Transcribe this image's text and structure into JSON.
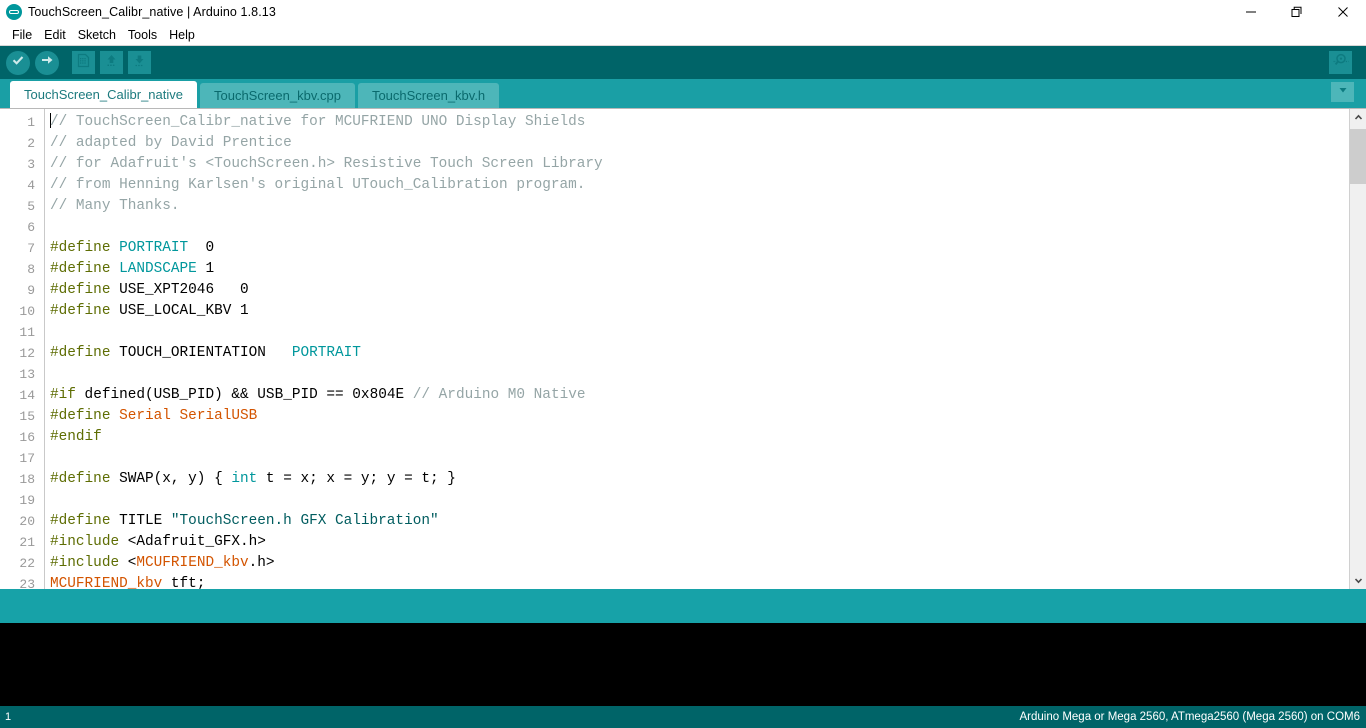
{
  "window": {
    "title": "TouchScreen_Calibr_native | Arduino 1.8.13",
    "app_icon": "arduino-logo-icon",
    "controls": {
      "minimize": "minimize-icon",
      "maximize": "restore-icon",
      "close": "close-icon"
    }
  },
  "menubar": {
    "items": [
      "File",
      "Edit",
      "Sketch",
      "Tools",
      "Help"
    ]
  },
  "toolbar": {
    "buttons": [
      {
        "name": "verify-button",
        "icon": "check-icon",
        "label": "Verify"
      },
      {
        "name": "upload-button",
        "icon": "arrow-right-icon",
        "label": "Upload"
      },
      {
        "name": "new-button",
        "icon": "new-document-icon",
        "label": "New"
      },
      {
        "name": "open-button",
        "icon": "arrow-up-icon",
        "label": "Open"
      },
      {
        "name": "save-button",
        "icon": "arrow-down-icon",
        "label": "Save"
      }
    ],
    "serial_monitor": {
      "name": "serial-monitor-button",
      "icon": "magnifier-icon",
      "label": "Serial Monitor"
    }
  },
  "tabs": {
    "items": [
      {
        "label": "TouchScreen_Calibr_native",
        "active": true
      },
      {
        "label": "TouchScreen_kbv.cpp",
        "active": false
      },
      {
        "label": "TouchScreen_kbv.h",
        "active": false
      }
    ],
    "menu_icon": "chevron-down-icon"
  },
  "editor": {
    "first_line": 1,
    "line_numbers": [
      1,
      2,
      3,
      4,
      5,
      6,
      7,
      8,
      9,
      10,
      11,
      12,
      13,
      14,
      15,
      16,
      17,
      18,
      19,
      20,
      21,
      22,
      23
    ],
    "lines": [
      {
        "n": 1,
        "tokens": [
          {
            "t": "// TouchScreen_Calibr_native for MCUFRIEND UNO Display Shields",
            "c": "comment"
          }
        ]
      },
      {
        "n": 2,
        "tokens": [
          {
            "t": "// adapted by David Prentice",
            "c": "comment"
          }
        ]
      },
      {
        "n": 3,
        "tokens": [
          {
            "t": "// for Adafruit's <TouchScreen.h> Resistive Touch Screen Library",
            "c": "comment"
          }
        ]
      },
      {
        "n": 4,
        "tokens": [
          {
            "t": "// from Henning Karlsen's original UTouch_Calibration program.",
            "c": "comment"
          }
        ]
      },
      {
        "n": 5,
        "tokens": [
          {
            "t": "// Many Thanks.",
            "c": "comment"
          }
        ]
      },
      {
        "n": 6,
        "tokens": []
      },
      {
        "n": 7,
        "tokens": [
          {
            "t": "#define",
            "c": "pre"
          },
          {
            "t": " ",
            "c": "plain"
          },
          {
            "t": "PORTRAIT",
            "c": "kw"
          },
          {
            "t": "  0",
            "c": "plain"
          }
        ]
      },
      {
        "n": 8,
        "tokens": [
          {
            "t": "#define",
            "c": "pre"
          },
          {
            "t": " ",
            "c": "plain"
          },
          {
            "t": "LANDSCAPE",
            "c": "kw"
          },
          {
            "t": " 1",
            "c": "plain"
          }
        ]
      },
      {
        "n": 9,
        "tokens": [
          {
            "t": "#define",
            "c": "pre"
          },
          {
            "t": " USE_XPT2046   0",
            "c": "plain"
          }
        ]
      },
      {
        "n": 10,
        "tokens": [
          {
            "t": "#define",
            "c": "pre"
          },
          {
            "t": " USE_LOCAL_KBV 1",
            "c": "plain"
          }
        ]
      },
      {
        "n": 11,
        "tokens": []
      },
      {
        "n": 12,
        "tokens": [
          {
            "t": "#define",
            "c": "pre"
          },
          {
            "t": " TOUCH_ORIENTATION   ",
            "c": "plain"
          },
          {
            "t": "PORTRAIT",
            "c": "kw"
          }
        ]
      },
      {
        "n": 13,
        "tokens": []
      },
      {
        "n": 14,
        "tokens": [
          {
            "t": "#if",
            "c": "pre"
          },
          {
            "t": " defined(USB_PID) ",
            "c": "plain"
          },
          {
            "t": "&&",
            "c": "plain"
          },
          {
            "t": " USB_PID == ",
            "c": "plain"
          },
          {
            "t": "0x804E",
            "c": "plain"
          },
          {
            "t": " ",
            "c": "plain"
          },
          {
            "t": "// Arduino M0 Native",
            "c": "comment"
          }
        ]
      },
      {
        "n": 15,
        "tokens": [
          {
            "t": "#define",
            "c": "pre"
          },
          {
            "t": " ",
            "c": "plain"
          },
          {
            "t": "Serial SerialUSB",
            "c": "obj"
          }
        ]
      },
      {
        "n": 16,
        "tokens": [
          {
            "t": "#endif",
            "c": "pre"
          }
        ]
      },
      {
        "n": 17,
        "tokens": []
      },
      {
        "n": 18,
        "tokens": [
          {
            "t": "#define",
            "c": "pre"
          },
          {
            "t": " SWAP(x, y) { ",
            "c": "plain"
          },
          {
            "t": "int",
            "c": "kw"
          },
          {
            "t": " t = x; x = y; y = t; }",
            "c": "plain"
          }
        ]
      },
      {
        "n": 19,
        "tokens": []
      },
      {
        "n": 20,
        "tokens": [
          {
            "t": "#define",
            "c": "pre"
          },
          {
            "t": " TITLE ",
            "c": "plain"
          },
          {
            "t": "\"TouchScreen.h GFX Calibration\"",
            "c": "str"
          }
        ]
      },
      {
        "n": 21,
        "tokens": [
          {
            "t": "#include",
            "c": "pre"
          },
          {
            "t": " <Adafruit_GFX.h>",
            "c": "plain"
          }
        ]
      },
      {
        "n": 22,
        "tokens": [
          {
            "t": "#include",
            "c": "pre"
          },
          {
            "t": " <",
            "c": "plain"
          },
          {
            "t": "MCUFRIEND_kbv",
            "c": "obj"
          },
          {
            "t": ".h>",
            "c": "plain"
          }
        ]
      },
      {
        "n": 23,
        "tokens": [
          {
            "t": "MCUFRIEND_kbv",
            "c": "obj"
          },
          {
            "t": " tft;",
            "c": "plain"
          }
        ]
      }
    ],
    "scrollbar": {
      "up_icon": "chevron-up-icon",
      "down_icon": "chevron-down-icon"
    }
  },
  "statusbar": {
    "line_indicator": "1",
    "board_info": "Arduino Mega or Mega 2560, ATmega2560 (Mega 2560) on COM6"
  },
  "colors": {
    "toolbar_bg": "#006468",
    "tabbar_bg": "#1a9fa5",
    "accent": "#00979c",
    "status_strip": "#17a2a8",
    "console_bg": "#000000",
    "comment": "#95a5a6",
    "preprocessor": "#5e6d03",
    "keyword": "#00979c",
    "object": "#d35400",
    "string": "#005c5f"
  }
}
